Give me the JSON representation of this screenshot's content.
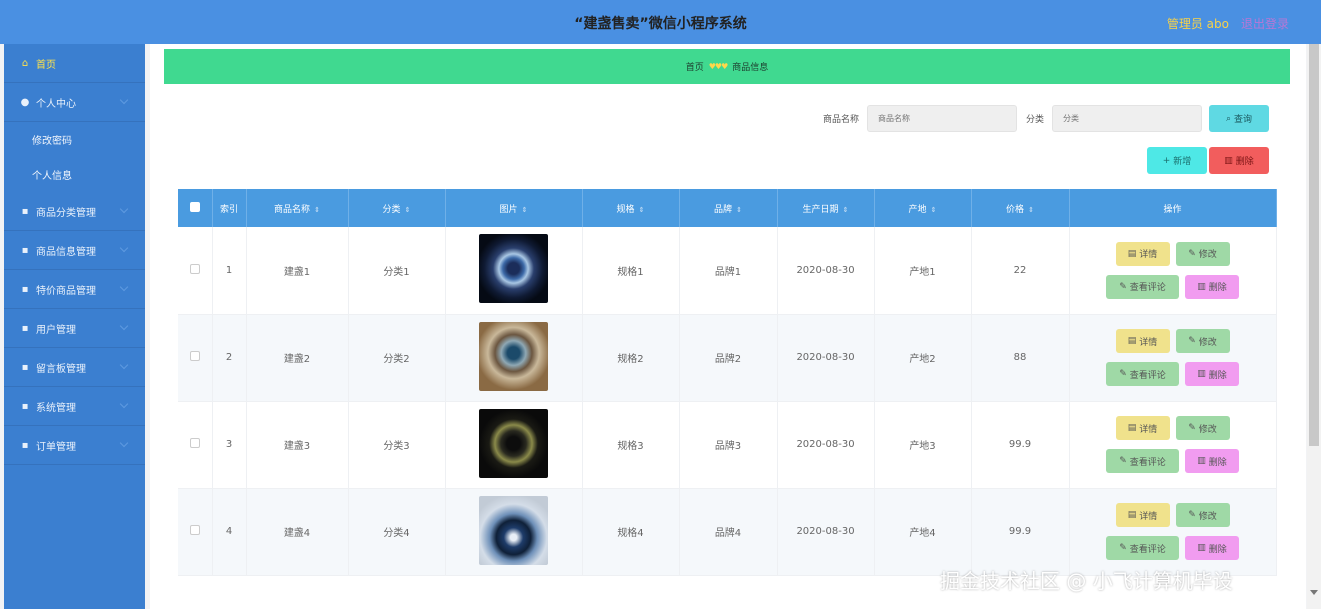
{
  "header": {
    "title": "“建盏售卖”微信小程序系统",
    "admin": "管理员 abo",
    "logout": "退出登录",
    "bg": "#4a90e2"
  },
  "sidebar": {
    "items": [
      {
        "label": "首页",
        "icon": "home-icon",
        "active": true
      },
      {
        "label": "个人中心",
        "icon": "user-icon",
        "sub": [
          "修改密码",
          "个人信息"
        ]
      },
      {
        "label": "商品分类管理",
        "icon": "category-icon"
      },
      {
        "label": "商品信息管理",
        "icon": "goods-icon"
      },
      {
        "label": "特价商品管理",
        "icon": "flag-icon"
      },
      {
        "label": "用户管理",
        "icon": "users-icon"
      },
      {
        "label": "留言板管理",
        "icon": "message-icon"
      },
      {
        "label": "系统管理",
        "icon": "settings-icon"
      },
      {
        "label": "订单管理",
        "icon": "order-icon"
      }
    ]
  },
  "breadcrumb": {
    "home": "首页",
    "sep": "♥♥♥",
    "current": "商品信息"
  },
  "search": {
    "name_label": "商品名称",
    "name_placeholder": "商品名称",
    "cat_label": "分类",
    "cat_placeholder": "分类",
    "query": "查询"
  },
  "actions": {
    "add": "新增",
    "delete": "删除"
  },
  "table": {
    "headers": [
      "索引",
      "商品名称",
      "分类",
      "图片",
      "规格",
      "品牌",
      "生产日期",
      "产地",
      "价格",
      "操作"
    ],
    "rows": [
      {
        "index": "1",
        "name": "建盏1",
        "category": "分类1",
        "spec": "规格1",
        "brand": "品牌1",
        "date": "2020-08-30",
        "origin": "产地1",
        "price": "22"
      },
      {
        "index": "2",
        "name": "建盏2",
        "category": "分类2",
        "spec": "规格2",
        "brand": "品牌2",
        "date": "2020-08-30",
        "origin": "产地2",
        "price": "88"
      },
      {
        "index": "3",
        "name": "建盏3",
        "category": "分类3",
        "spec": "规格3",
        "brand": "品牌3",
        "date": "2020-08-30",
        "origin": "产地3",
        "price": "99.9"
      },
      {
        "index": "4",
        "name": "建盏4",
        "category": "分类4",
        "spec": "规格4",
        "brand": "品牌4",
        "date": "2020-08-30",
        "origin": "产地4",
        "price": "99.9"
      }
    ],
    "ops": {
      "detail": "详情",
      "edit": "修改",
      "comments": "查看评论",
      "remove": "删除"
    }
  },
  "watermark": "掘金技术社区 @ 小飞计算机毕设"
}
